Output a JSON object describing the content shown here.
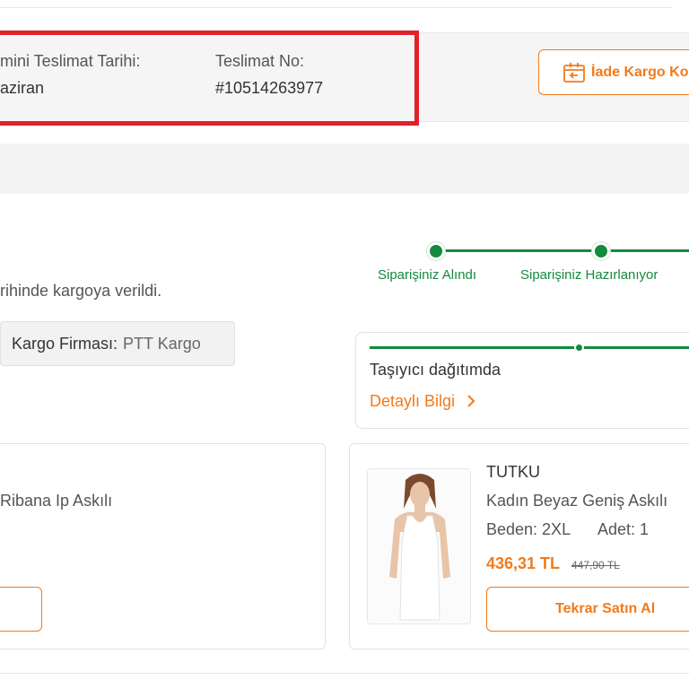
{
  "delivery": {
    "estimated_date_label": "mini Teslimat Tarihi:",
    "estimated_date_value": "aziran",
    "delivery_no_label": "Teslimat No:",
    "delivery_no_value": "#10514263977"
  },
  "return_button": {
    "label": "İade Kargo Ko",
    "icon": "return-box-icon"
  },
  "cargo": {
    "shipped_text": "rihinde kargoya verildi.",
    "company_key": "Kargo Firması:",
    "company_value": "PTT Kargo"
  },
  "tracker": {
    "steps": [
      "Siparişiniz Alındı",
      "Siparişiniz Hazırlanıyor"
    ],
    "color": "#138a3e"
  },
  "shipment_status": {
    "status": "Taşıyıcı dağıtımda",
    "detail_link": "Detaylı Bilgi",
    "chevron_icon": "chevron-right-icon"
  },
  "products": {
    "left": {
      "name": "Ribana Ip Askılı"
    },
    "right": {
      "brand": "TUTKU",
      "name": "Kadın Beyaz Geniş Askılı",
      "size": "Beden: 2XL",
      "quantity": "Adet: 1",
      "price": "436,31 TL",
      "old_price": "447,90 TL",
      "rebuy_label": "Tekrar Satın Al"
    }
  },
  "colors": {
    "accent": "#f27a1a",
    "success": "#138a3e",
    "highlight": "#e3202a"
  }
}
